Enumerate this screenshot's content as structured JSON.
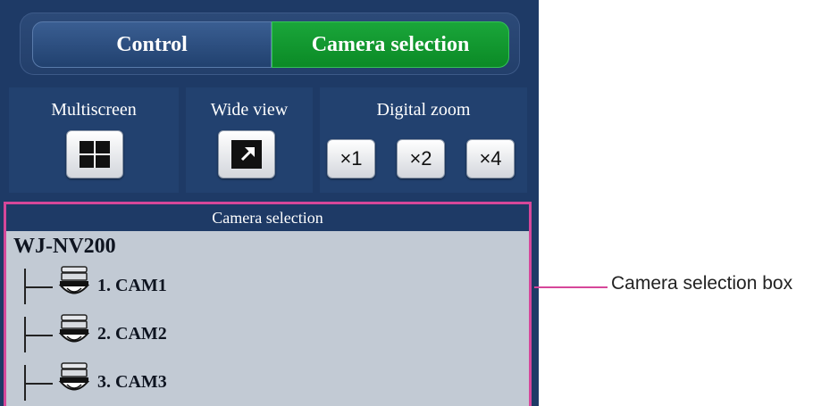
{
  "tabs": {
    "control_label": "Control",
    "camera_selection_label": "Camera selection",
    "active": "camera_selection",
    "active_color": "#0b8a26"
  },
  "tools": {
    "multiscreen_label": "Multiscreen",
    "wide_view_label": "Wide view",
    "digital_zoom_label": "Digital zoom",
    "zoom_buttons": [
      "×1",
      "×2",
      "×4"
    ],
    "multiscreen_icon": "grid-2x2-icon",
    "wide_view_icon": "expand-arrow-icon"
  },
  "camera_selection": {
    "header": "Camera selection",
    "recorder": "WJ-NV200",
    "cameras": [
      {
        "label": "1. CAM1",
        "icon": "dome-camera-icon"
      },
      {
        "label": "2. CAM2",
        "icon": "dome-camera-icon"
      },
      {
        "label": "3. CAM3",
        "icon": "dome-camera-icon"
      }
    ],
    "highlight_color": "#d6479a"
  },
  "callout": {
    "text": "Camera selection box"
  },
  "colors": {
    "panel_bg": "#1e3a66",
    "list_bg": "#c2cad4"
  }
}
